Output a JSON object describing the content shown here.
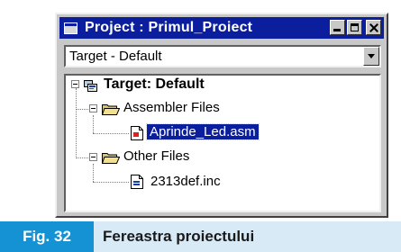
{
  "window": {
    "title": "Project : Primul_Proiect"
  },
  "target_select": {
    "value": "Target - Default"
  },
  "tree": {
    "root": {
      "label": "Target: Default",
      "icon": "project-icon"
    },
    "groups": [
      {
        "label": "Assembler Files",
        "icon": "folder-open-icon",
        "files": [
          {
            "label": "Aprinde_Led.asm",
            "icon": "asm-file-icon",
            "selected": true
          }
        ]
      },
      {
        "label": "Other Files",
        "icon": "folder-open-icon",
        "files": [
          {
            "label": "2313def.inc",
            "icon": "inc-file-icon",
            "selected": false
          }
        ]
      }
    ]
  },
  "caption": {
    "figure": "Fig. 32",
    "text": "Fereastra proiectului"
  },
  "colors": {
    "titlebar": "#0a1e9e",
    "selection": "#0a1e9e",
    "figure_badge": "#1592d4",
    "caption_band": "#d9eaf7"
  }
}
